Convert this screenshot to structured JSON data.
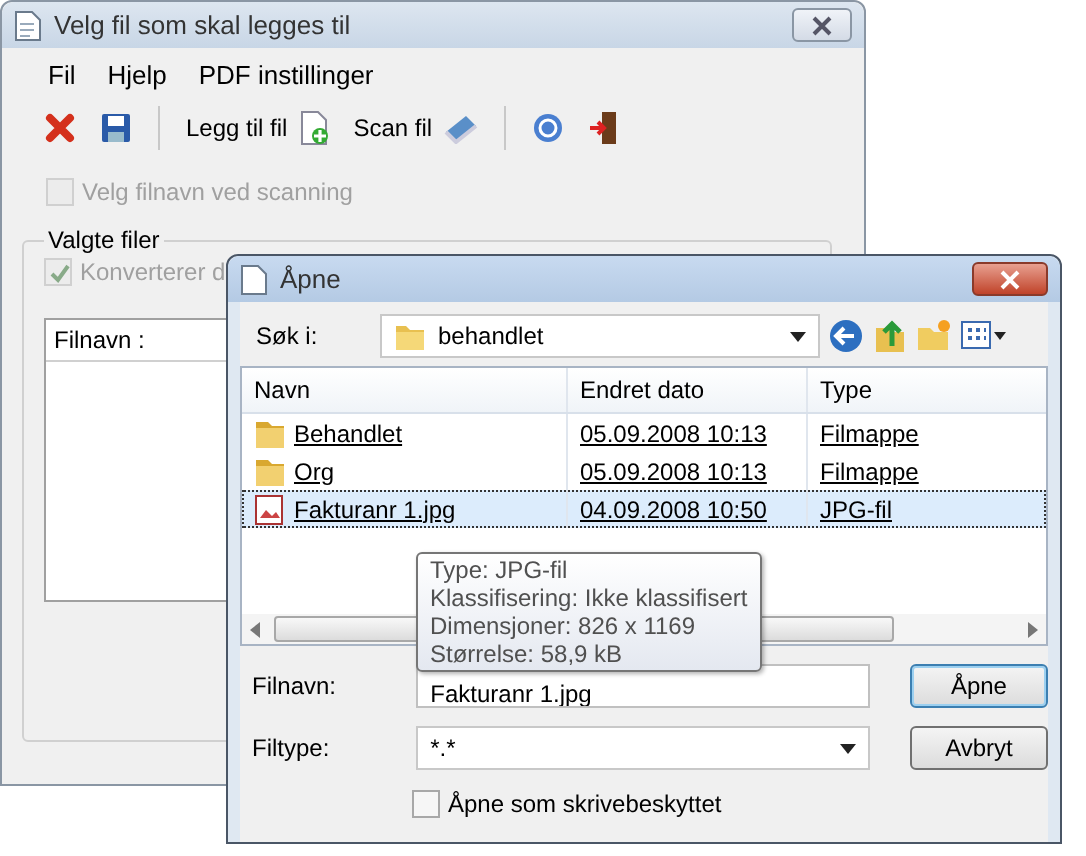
{
  "main_window": {
    "title": "Velg fil som skal legges til",
    "menu": [
      "Fil",
      "Hjelp",
      "PDF instillinger"
    ],
    "toolbar": [
      {
        "kind": "delete"
      },
      {
        "kind": "save"
      },
      {
        "kind": "separator"
      },
      {
        "kind": "add-file",
        "label": "Legg til fil"
      },
      {
        "kind": "scan",
        "label": "Scan fil"
      },
      {
        "kind": "separator"
      },
      {
        "kind": "help"
      },
      {
        "kind": "exit"
      }
    ],
    "scan_option": {
      "label": "Velg filnavn ved scanning",
      "checked": false,
      "disabled": true
    },
    "group": {
      "title": "Valgte filer",
      "convert_option": {
        "label": "Konverterer d",
        "checked": true,
        "disabled": true
      },
      "list_columns": [
        "Filnavn :"
      ]
    }
  },
  "dialog": {
    "title": "Åpne",
    "look_in": {
      "label": "Søk i:",
      "value": "behandlet"
    },
    "columns": [
      "Navn",
      "Endret dato",
      "Type"
    ],
    "rows": [
      {
        "kind": "folder",
        "name": "Behandlet",
        "date": "05.09.2008 10:13",
        "type": "Filmappe",
        "selected": false
      },
      {
        "kind": "folder",
        "name": "Org",
        "date": "05.09.2008 10:13",
        "type": "Filmappe",
        "selected": false
      },
      {
        "kind": "image",
        "name": "Fakturanr 1.jpg",
        "date": "04.09.2008 10:50",
        "type": "JPG-fil",
        "selected": true
      }
    ],
    "tooltip": [
      "Type: JPG-fil",
      "Klassifisering: Ikke klassifisert",
      "Dimensjoner: 826 x 1169",
      "Størrelse: 58,9 kB"
    ],
    "filename": {
      "label": "Filnavn:",
      "value": "Fakturanr 1.jpg"
    },
    "filetype": {
      "label": "Filtype:",
      "value": "*.*"
    },
    "buttons": [
      "Åpne",
      "Avbryt"
    ],
    "readonly_option": {
      "label": "Åpne som skrivebeskyttet",
      "checked": false
    }
  }
}
